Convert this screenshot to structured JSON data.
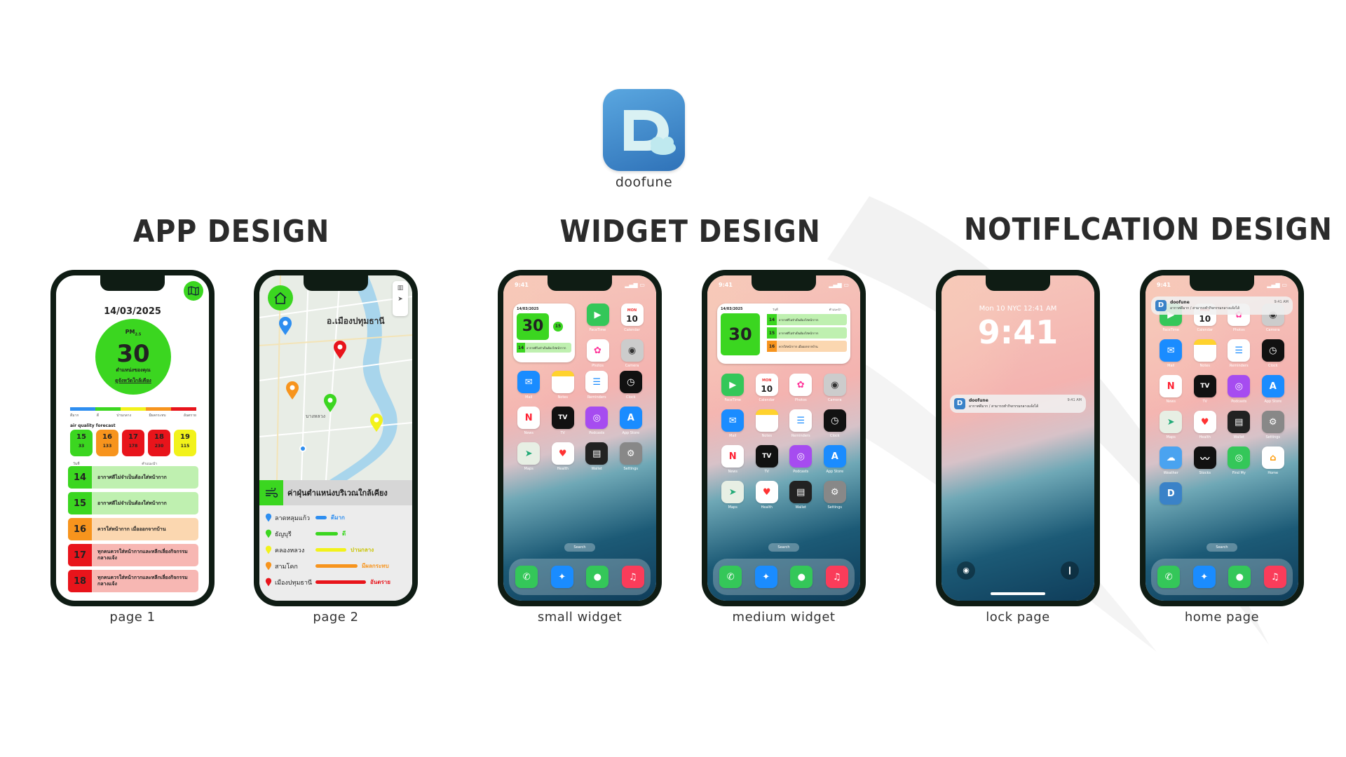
{
  "brand": {
    "name": "doofune",
    "logo_letter": "D",
    "colors": {
      "accent_green": "#3bd620",
      "logo_blue": "#3a82c8"
    }
  },
  "sections": {
    "app": "APP DESIGN",
    "widget": "WIDGET DESIGN",
    "notification": "NOTIFLCATION DESIGN"
  },
  "captions": {
    "page1": "page 1",
    "page2": "page 2",
    "small_widget": "small widget",
    "medium_widget": "medium widget",
    "lock_page": "lock page",
    "home_page": "home page"
  },
  "page1": {
    "date": "14/03/2025",
    "pm_label": "PM",
    "pm_sub": "2.5",
    "pm_value": "30",
    "location_label": "ตำแหน่งของคุณ",
    "nearby_link": "ดูจังหวัดใกล้เคียง",
    "scale_colors": [
      "#2e8ef0",
      "#3bd620",
      "#f2f21a",
      "#f7941d",
      "#e8141b"
    ],
    "scale_labels": [
      "ดีมาก",
      "ดี",
      "ปานกลาง",
      "มีผลกระทบ",
      "อันตราย"
    ],
    "forecast_title": "air quality forecast",
    "forecast": [
      {
        "day": "15",
        "value": "33",
        "color": "#3bd620"
      },
      {
        "day": "16",
        "value": "133",
        "color": "#f7941d"
      },
      {
        "day": "17",
        "value": "178",
        "color": "#e8141b"
      },
      {
        "day": "18",
        "value": "230",
        "color": "#e8141b"
      },
      {
        "day": "19",
        "value": "115",
        "color": "#f2f21a"
      }
    ],
    "day_header": [
      "วันที่",
      "คำแนะนำ"
    ],
    "days": [
      {
        "day": "14",
        "text": "อากาศดีไม่จำเป็นต้องใส่หน้ากาก",
        "num_color": "#3bd620",
        "bg": "#bff0b0"
      },
      {
        "day": "15",
        "text": "อากาศดีไม่จำเป็นต้องใส่หน้ากาก",
        "num_color": "#3bd620",
        "bg": "#bff0b0"
      },
      {
        "day": "16",
        "text": "ควรใส่หน้ากาก เมื่อออกจากบ้าน",
        "num_color": "#f7941d",
        "bg": "#fbd7b0"
      },
      {
        "day": "17",
        "text": "ทุกคนควรใส่หน้ากากและหลีกเลี่ยงกิจกรรมกลางแจ้ง",
        "num_color": "#e8141b",
        "bg": "#f7b7b3"
      },
      {
        "day": "18",
        "text": "ทุกคนควรใส่หน้ากากและหลีกเลี่ยงกิจกรรมกลางแจ้ง",
        "num_color": "#e8141b",
        "bg": "#f7b7b3"
      }
    ]
  },
  "page2": {
    "town": "อ.เมืองปทุมธานี",
    "district": "บางหลวง",
    "bar_title": "ค่าฝุ่นตำแหน่งบริเวณใกล้เคียง",
    "stations": [
      {
        "name": "ลาดหลุมแก้ว",
        "level": "ดีมาก",
        "color": "#2e8ef0",
        "share": 0.2
      },
      {
        "name": "ธัญบุรี",
        "level": "ดี",
        "color": "#3bd620",
        "share": 0.4
      },
      {
        "name": "คลองหลวง",
        "level": "ปานกลาง",
        "color": "#f2f21a",
        "share": 0.55
      },
      {
        "name": "สามโคก",
        "level": "มีผลกระทบ",
        "color": "#f7941d",
        "share": 0.75
      },
      {
        "name": "เมืองปทุมธานี",
        "level": "อันตราย",
        "color": "#e8141b",
        "share": 0.9
      }
    ]
  },
  "ios": {
    "time": "9:41",
    "lock_date": "Mon 10  NYC 12:41 AM",
    "calendar_day": "MON",
    "calendar_num": "10",
    "search": "Search",
    "apps": [
      "FaceTime",
      "Calendar",
      "Photos",
      "Camera",
      "Mail",
      "Notes",
      "Reminders",
      "Clock",
      "News",
      "TV",
      "Podcasts",
      "App Store",
      "Maps",
      "Health",
      "Wallet",
      "Settings"
    ],
    "home_extra_apps": [
      "Weather",
      "Stocks",
      "Find My",
      "Home"
    ]
  },
  "widget": {
    "date": "14/03/2025",
    "value": "30",
    "next_day": "15",
    "line1_day": "14",
    "line2_day": "15",
    "line3_day": "16",
    "hdr_day": "วันที่",
    "hdr_tip": "คำแนะนำ",
    "msg_good": "อากาศดีไม่จำเป็นต้องใส่หน้ากาก",
    "msg_mask": "ควรใส่หน้ากาก เมื่อออกจากบ้าน"
  },
  "notification": {
    "app": "doofune",
    "message": "อากาศดีมาก / สามารถทำกิจกรรมกลางแจ้งได้",
    "time": "9:41 AM"
  }
}
